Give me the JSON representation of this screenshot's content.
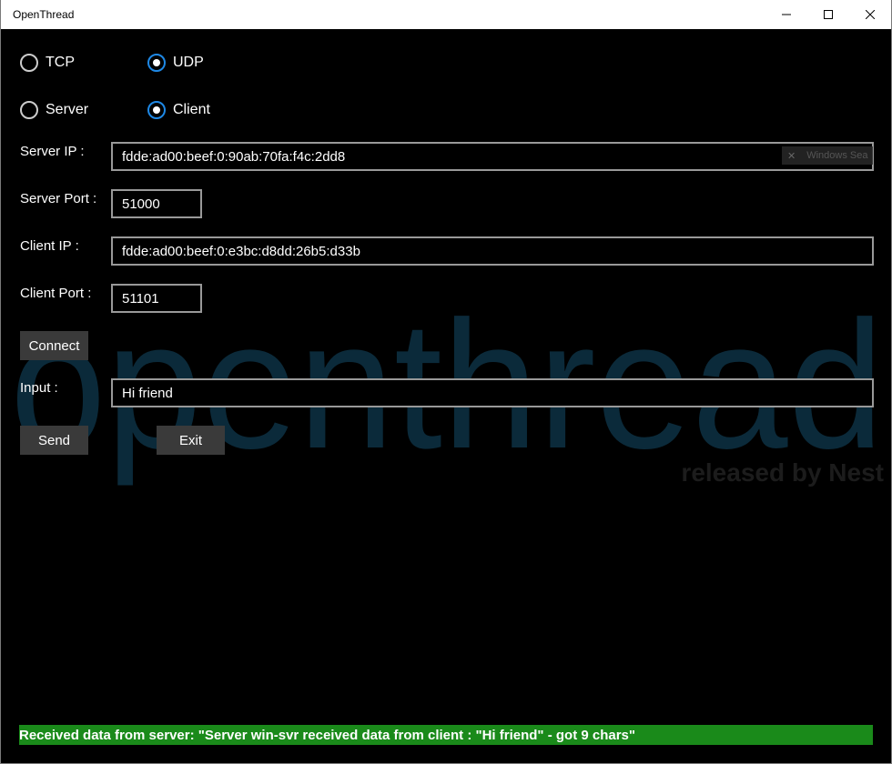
{
  "window": {
    "title": "OpenThread"
  },
  "protocol": {
    "tcp_label": "TCP",
    "udp_label": "UDP",
    "selected": "UDP"
  },
  "role": {
    "server_label": "Server",
    "client_label": "Client",
    "selected": "Client"
  },
  "fields": {
    "server_ip_label": "Server IP :",
    "server_ip_value": "fdde:ad00:beef:0:90ab:70fa:f4c:2dd8",
    "server_port_label": "Server Port :",
    "server_port_value": "51000",
    "client_ip_label": "Client IP :",
    "client_ip_value": "fdde:ad00:beef:0:e3bc:d8dd:26b5:d33b",
    "client_port_label": "Client Port :",
    "client_port_value": "51101",
    "input_label": "Input :",
    "input_value": "Hi friend"
  },
  "buttons": {
    "connect": "Connect",
    "send": "Send",
    "exit": "Exit"
  },
  "overlay": {
    "search_hint": "Windows Sea"
  },
  "watermark": {
    "brand": "openthread",
    "tagline": "released by Nest"
  },
  "status": {
    "message": "Received data from server: \"Server win-svr received data from client : \"Hi friend\" - got 9 chars\""
  },
  "colors": {
    "accent": "#1e88e5",
    "status_bg": "#1a8a1a",
    "watermark_text": "#0b2a3a",
    "watermark_tag": "#1c1c1c"
  }
}
